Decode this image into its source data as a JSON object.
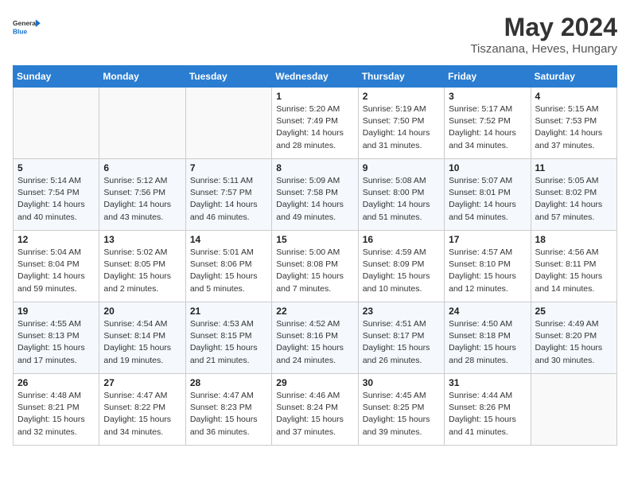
{
  "header": {
    "logo_general": "General",
    "logo_blue": "Blue",
    "title": "May 2024",
    "subtitle": "Tiszanana, Heves, Hungary"
  },
  "weekdays": [
    "Sunday",
    "Monday",
    "Tuesday",
    "Wednesday",
    "Thursday",
    "Friday",
    "Saturday"
  ],
  "weeks": [
    [
      {
        "day": "",
        "info": ""
      },
      {
        "day": "",
        "info": ""
      },
      {
        "day": "",
        "info": ""
      },
      {
        "day": "1",
        "info": "Sunrise: 5:20 AM\nSunset: 7:49 PM\nDaylight: 14 hours\nand 28 minutes."
      },
      {
        "day": "2",
        "info": "Sunrise: 5:19 AM\nSunset: 7:50 PM\nDaylight: 14 hours\nand 31 minutes."
      },
      {
        "day": "3",
        "info": "Sunrise: 5:17 AM\nSunset: 7:52 PM\nDaylight: 14 hours\nand 34 minutes."
      },
      {
        "day": "4",
        "info": "Sunrise: 5:15 AM\nSunset: 7:53 PM\nDaylight: 14 hours\nand 37 minutes."
      }
    ],
    [
      {
        "day": "5",
        "info": "Sunrise: 5:14 AM\nSunset: 7:54 PM\nDaylight: 14 hours\nand 40 minutes."
      },
      {
        "day": "6",
        "info": "Sunrise: 5:12 AM\nSunset: 7:56 PM\nDaylight: 14 hours\nand 43 minutes."
      },
      {
        "day": "7",
        "info": "Sunrise: 5:11 AM\nSunset: 7:57 PM\nDaylight: 14 hours\nand 46 minutes."
      },
      {
        "day": "8",
        "info": "Sunrise: 5:09 AM\nSunset: 7:58 PM\nDaylight: 14 hours\nand 49 minutes."
      },
      {
        "day": "9",
        "info": "Sunrise: 5:08 AM\nSunset: 8:00 PM\nDaylight: 14 hours\nand 51 minutes."
      },
      {
        "day": "10",
        "info": "Sunrise: 5:07 AM\nSunset: 8:01 PM\nDaylight: 14 hours\nand 54 minutes."
      },
      {
        "day": "11",
        "info": "Sunrise: 5:05 AM\nSunset: 8:02 PM\nDaylight: 14 hours\nand 57 minutes."
      }
    ],
    [
      {
        "day": "12",
        "info": "Sunrise: 5:04 AM\nSunset: 8:04 PM\nDaylight: 14 hours\nand 59 minutes."
      },
      {
        "day": "13",
        "info": "Sunrise: 5:02 AM\nSunset: 8:05 PM\nDaylight: 15 hours\nand 2 minutes."
      },
      {
        "day": "14",
        "info": "Sunrise: 5:01 AM\nSunset: 8:06 PM\nDaylight: 15 hours\nand 5 minutes."
      },
      {
        "day": "15",
        "info": "Sunrise: 5:00 AM\nSunset: 8:08 PM\nDaylight: 15 hours\nand 7 minutes."
      },
      {
        "day": "16",
        "info": "Sunrise: 4:59 AM\nSunset: 8:09 PM\nDaylight: 15 hours\nand 10 minutes."
      },
      {
        "day": "17",
        "info": "Sunrise: 4:57 AM\nSunset: 8:10 PM\nDaylight: 15 hours\nand 12 minutes."
      },
      {
        "day": "18",
        "info": "Sunrise: 4:56 AM\nSunset: 8:11 PM\nDaylight: 15 hours\nand 14 minutes."
      }
    ],
    [
      {
        "day": "19",
        "info": "Sunrise: 4:55 AM\nSunset: 8:13 PM\nDaylight: 15 hours\nand 17 minutes."
      },
      {
        "day": "20",
        "info": "Sunrise: 4:54 AM\nSunset: 8:14 PM\nDaylight: 15 hours\nand 19 minutes."
      },
      {
        "day": "21",
        "info": "Sunrise: 4:53 AM\nSunset: 8:15 PM\nDaylight: 15 hours\nand 21 minutes."
      },
      {
        "day": "22",
        "info": "Sunrise: 4:52 AM\nSunset: 8:16 PM\nDaylight: 15 hours\nand 24 minutes."
      },
      {
        "day": "23",
        "info": "Sunrise: 4:51 AM\nSunset: 8:17 PM\nDaylight: 15 hours\nand 26 minutes."
      },
      {
        "day": "24",
        "info": "Sunrise: 4:50 AM\nSunset: 8:18 PM\nDaylight: 15 hours\nand 28 minutes."
      },
      {
        "day": "25",
        "info": "Sunrise: 4:49 AM\nSunset: 8:20 PM\nDaylight: 15 hours\nand 30 minutes."
      }
    ],
    [
      {
        "day": "26",
        "info": "Sunrise: 4:48 AM\nSunset: 8:21 PM\nDaylight: 15 hours\nand 32 minutes."
      },
      {
        "day": "27",
        "info": "Sunrise: 4:47 AM\nSunset: 8:22 PM\nDaylight: 15 hours\nand 34 minutes."
      },
      {
        "day": "28",
        "info": "Sunrise: 4:47 AM\nSunset: 8:23 PM\nDaylight: 15 hours\nand 36 minutes."
      },
      {
        "day": "29",
        "info": "Sunrise: 4:46 AM\nSunset: 8:24 PM\nDaylight: 15 hours\nand 37 minutes."
      },
      {
        "day": "30",
        "info": "Sunrise: 4:45 AM\nSunset: 8:25 PM\nDaylight: 15 hours\nand 39 minutes."
      },
      {
        "day": "31",
        "info": "Sunrise: 4:44 AM\nSunset: 8:26 PM\nDaylight: 15 hours\nand 41 minutes."
      },
      {
        "day": "",
        "info": ""
      }
    ]
  ]
}
